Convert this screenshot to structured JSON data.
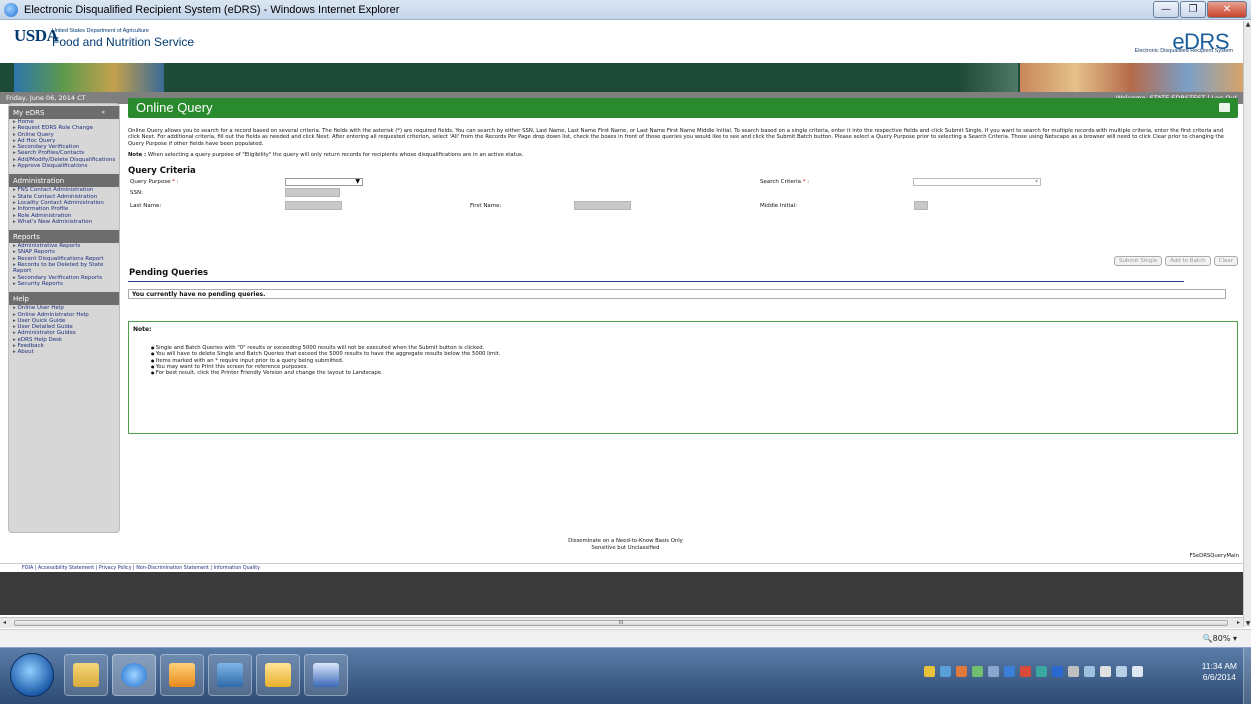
{
  "window": {
    "title": "Electronic Disqualified Recipient System (eDRS) - Windows Internet Explorer",
    "min": "—",
    "max": "❐",
    "close": "✕"
  },
  "header": {
    "usda": "USDA",
    "usda_sub": "United States Department of Agriculture",
    "agency": "Food and Nutrition Service",
    "logo": "eDRS",
    "logo_sub": "Electronic Disqualified Recipient System"
  },
  "datebar": {
    "date": "Friday, June 06, 2014 CT",
    "welcome": "Welcome, STATE EDRSTEST | Log Out"
  },
  "nav": {
    "my_edrs": {
      "title": "My eDRS",
      "collapse": "«",
      "items": [
        "Home",
        "Request EDRS Role Change",
        "Online Query",
        "Ad Hoc Query",
        "Secondary Verification",
        "Search Profiles/Contacts",
        "Add/Modify/Delete Disqualifications",
        "Approve Disqualifications"
      ]
    },
    "administration": {
      "title": "Administration",
      "items": [
        "FNS Contact Administration",
        "State Contact Administration",
        "Locality Contact Administration",
        "Information Profile",
        "Role Administration",
        "What's New Administration"
      ]
    },
    "reports": {
      "title": "Reports",
      "items": [
        "Administrative Reports",
        "SNAP Reports",
        "Recent Disqualifications Report",
        "Records to be Deleted by State Report",
        "Secondary Verification Reports",
        "Security Reports"
      ]
    },
    "help": {
      "title": "Help",
      "items": [
        "Online User Help",
        "Online Administrator Help",
        "User Quick Guide",
        "User Detailed Guide",
        "Administrator Guides",
        "eDRS Help Desk",
        "Feedback",
        "About"
      ]
    }
  },
  "main": {
    "title": "Online Query",
    "description": "Online Query allows you to search for a record based on several criteria. The fields with the asterisk (*) are required fields. You can search by either SSN, Last Name, Last Name First Name, or Last Name First Name Middle Initial. To search based on a single criteria, enter it into the respective fields and click Submit Single. If you want to search for multiple records with multiple criteria, enter the first criteria and click Next. For additional criteria, fill out the fields as needed and click Next. After entering all requested criterion, select 'All' from the Records Per Page drop down list, check the boxes in front of those queries you would like to see and click the Submit Batch button. Please select a Query Purpose prior to selecting a Search Criteria. Those using Netscape as a browser will need to click Clear prior to changing the Query Purpose if other fields have been populated.",
    "note_label": "Note :",
    "note_text": "When selecting a query purpose of \"Eligibility\" the query will only return records for recipients whose disqualifications are in an active status.",
    "query_criteria": "Query Criteria",
    "form": {
      "query_purpose": "Query Purpose",
      "search_criteria": "Search Criteria",
      "ssn": "SSN:",
      "last_name": "Last Name:",
      "first_name": "First Name:",
      "middle_initial": "Middle Initial:",
      "required_mark": "*",
      "colon": ":"
    },
    "buttons": {
      "submit_single": "Submit Single",
      "add_to_batch": "Add to Batch",
      "clear": "Clear"
    },
    "pending_title": "Pending Queries",
    "pending_empty": "You currently have no pending queries.",
    "note_box": {
      "title": "Note:",
      "items": [
        "Single and Batch Queries with \"0\" results or exceeding 5000 results will not be executed when the Submit button is clicked.",
        "You will have to delete Single and Batch Queries that exceed the 5000 results to have the aggregate results below the 5000 limit.",
        "Items marked with an  *  require input prior to a query being submitted.",
        "You may want to Print this screen for reference purposes.",
        "For best result, click the Printer Friendly Version and change the layout to Landscape."
      ]
    },
    "dissem_1": "Disseminate on a Need-to-Know Basis Only",
    "dissem_2": "Sensitive but Unclassified",
    "screen_name": "FSeDRSQueryMain",
    "footer": "FOIA | Accessibility Statement | Privacy Policy | Non-Discrimination Statement | Information Quality"
  },
  "statusbar": {
    "zoom": "🔍80%  ▾",
    "scroll_grip": "III"
  },
  "taskbar": {
    "time": "11:34 AM",
    "date": "6/6/2014"
  },
  "colors": {
    "brand_green": "#2a8a2e",
    "nav_gray": "#d7d7d7",
    "dark_green_banner": "#1d4a37"
  }
}
